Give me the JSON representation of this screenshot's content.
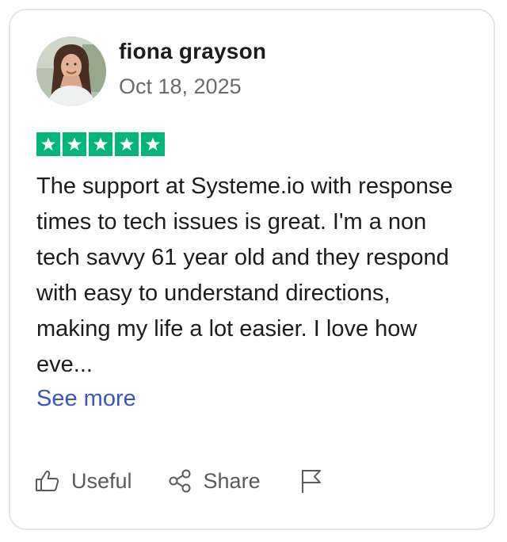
{
  "review": {
    "reviewer_name": "fiona grayson",
    "date": "Oct 18, 2025",
    "rating": 5,
    "max_rating": 5,
    "text": "The support at Systeme.io with response times to tech issues is great. I'm a non tech savvy 61 year old and they respond with easy to understand directions, making my life a lot easier. I love how eve...",
    "see_more_label": "See more"
  },
  "actions": {
    "useful_label": "Useful",
    "share_label": "Share",
    "useful_icon": "thumbs-up-icon",
    "share_icon": "share-icon",
    "report_icon": "flag-icon"
  },
  "colors": {
    "star_green": "#00b67a",
    "link_blue": "#3b55c6",
    "text_dark": "#1c1c1c",
    "text_muted": "#6b6b6b",
    "card_border": "#e4e4e4"
  }
}
